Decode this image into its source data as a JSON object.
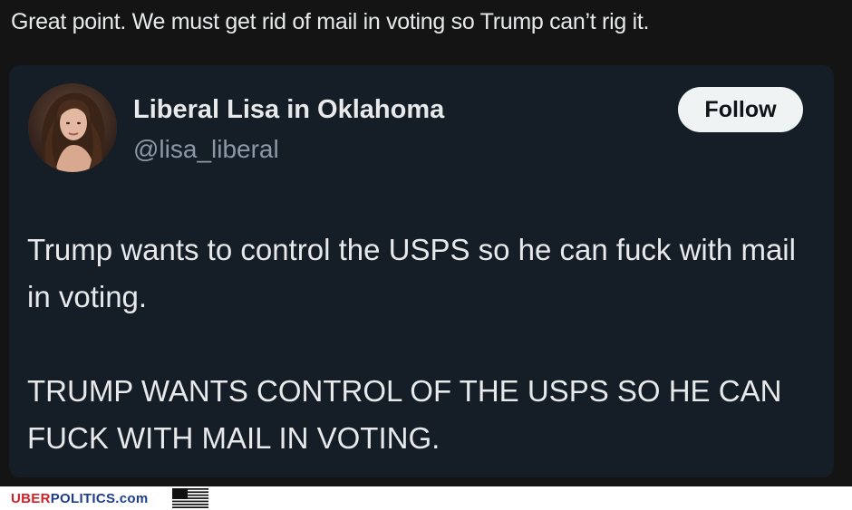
{
  "comment": {
    "text": "Great point. We must get rid of mail in voting so Trump can’t rig it."
  },
  "tweet": {
    "display_name": "Liberal Lisa in Oklahoma",
    "handle": "@lisa_liberal",
    "follow_label": "Follow",
    "paragraphs": [
      "Trump wants to control the USPS so he can fuck with mail in voting.",
      "TRUMP WANTS CONTROL OF THE USPS SO HE CAN FUCK WITH MAIL IN VOTING."
    ]
  },
  "watermark": {
    "part1": "UBER",
    "part2": "POLITICS.com",
    "icon": "us-flag-icon"
  },
  "colors": {
    "background": "#141414",
    "card": "#151d27",
    "text": "#e7e9ea",
    "muted": "#8b98a5",
    "follow_bg": "#eff3f4",
    "brand_red": "#d01f26",
    "brand_blue": "#1d3d8f"
  }
}
